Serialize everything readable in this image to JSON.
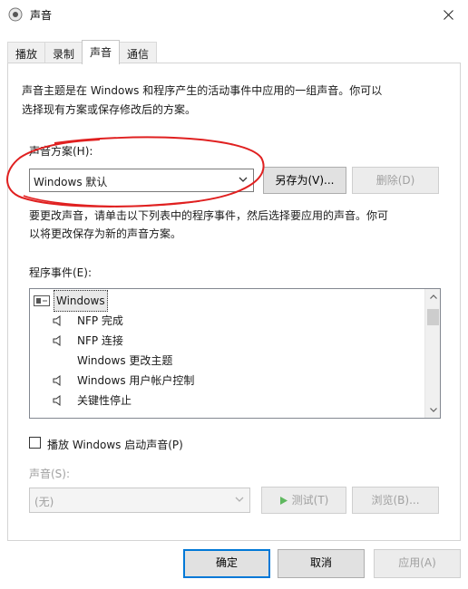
{
  "window": {
    "title": "声音",
    "close_icon": "close-icon"
  },
  "tabs": [
    {
      "label": "播放",
      "active": false
    },
    {
      "label": "录制",
      "active": false
    },
    {
      "label": "声音",
      "active": true
    },
    {
      "label": "通信",
      "active": false
    }
  ],
  "sounds_tab": {
    "theme_desc_line1": "声音主题是在 Windows 和程序产生的活动事件中应用的一组声音。你可以",
    "theme_desc_line2": "选择现有方案或保存修改后的方案。",
    "scheme_label": "声音方案(H):",
    "scheme_value": "Windows 默认",
    "save_as_label": "另存为(V)...",
    "delete_label": "删除(D)",
    "change_desc_line1": "要更改声音，请单击以下列表中的程序事件，然后选择要应用的声音。你可",
    "change_desc_line2": "以将更改保存为新的声音方案。",
    "events_label": "程序事件(E):",
    "events": [
      {
        "label": "Windows",
        "has_sound": false,
        "group": true
      },
      {
        "label": "NFP 完成",
        "has_sound": true
      },
      {
        "label": "NFP 连接",
        "has_sound": true
      },
      {
        "label": "Windows 更改主题",
        "has_sound": false
      },
      {
        "label": "Windows 用户帐户控制",
        "has_sound": true
      },
      {
        "label": "关键性停止",
        "has_sound": true
      }
    ],
    "startup_checkbox_label": "播放 Windows 启动声音(P)",
    "startup_checked": false,
    "sound_label": "声音(S):",
    "sound_value": "(无)",
    "test_label": "测试(T)",
    "browse_label": "浏览(B)..."
  },
  "footer": {
    "ok_label": "确定",
    "cancel_label": "取消",
    "apply_label": "应用(A)"
  },
  "colors": {
    "accent": "#0078d7",
    "annotation": "#e02020",
    "disabled": "#a0a0a0"
  }
}
